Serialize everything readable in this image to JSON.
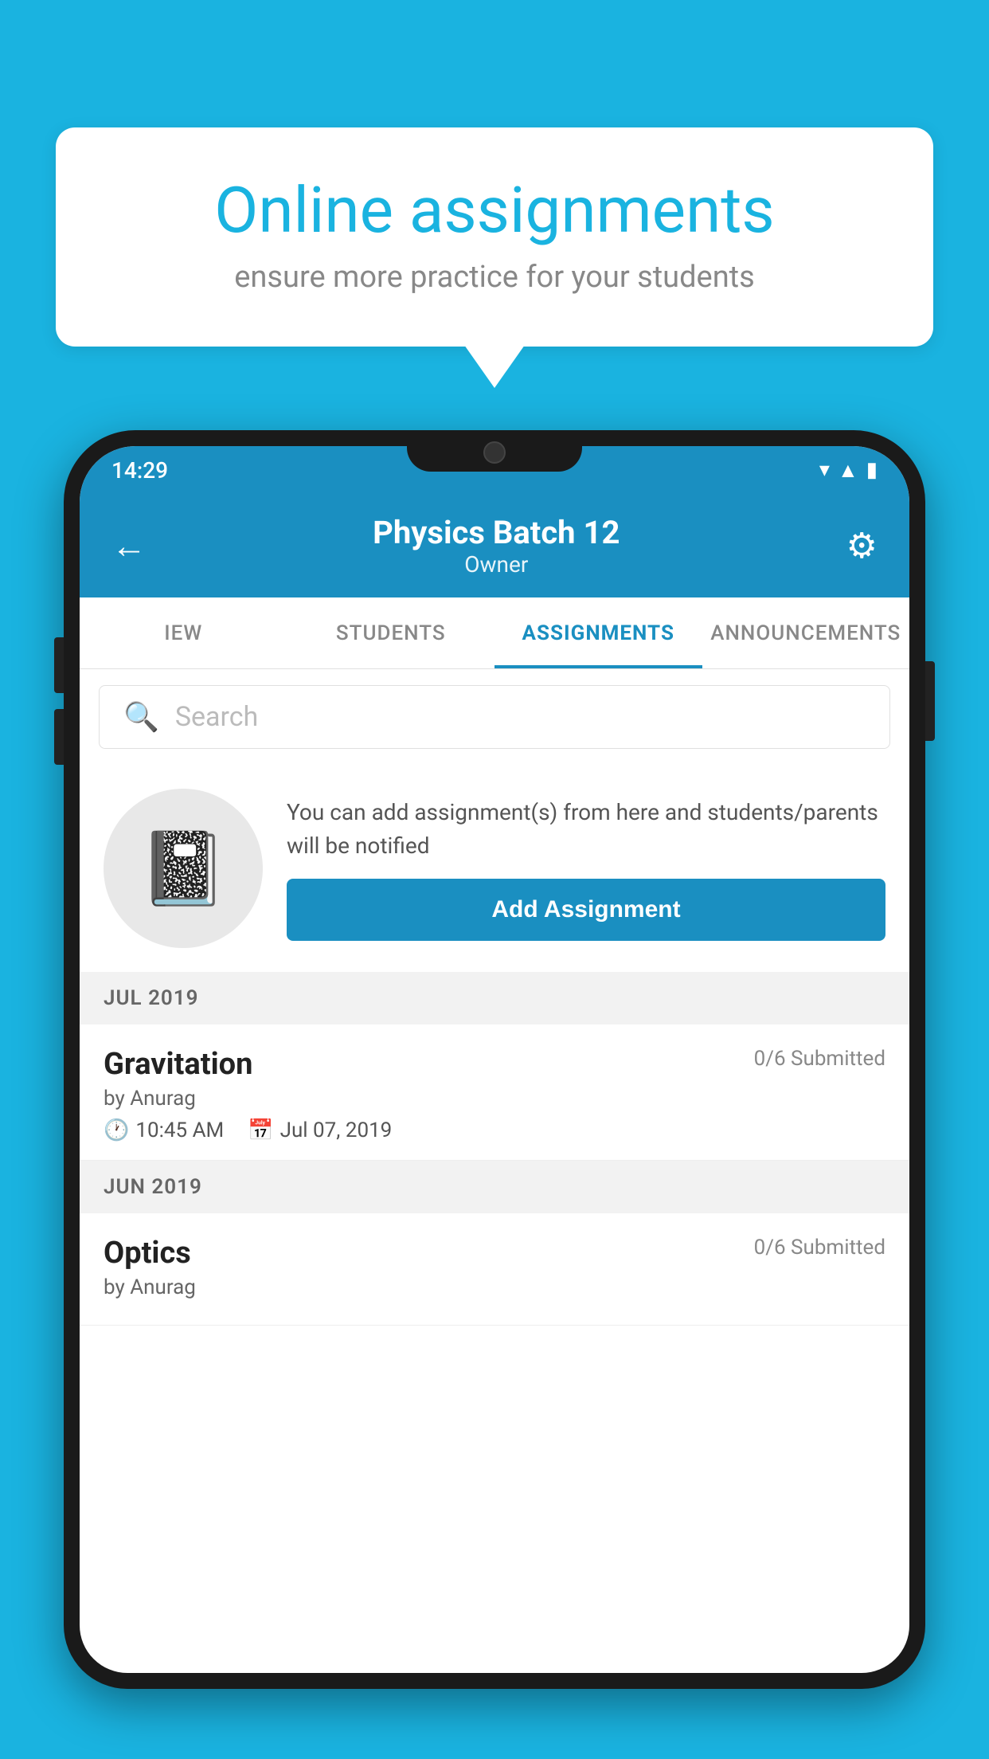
{
  "background_color": "#1ab3e0",
  "bubble": {
    "title": "Online assignments",
    "subtitle": "ensure more practice for your students"
  },
  "status_bar": {
    "time": "14:29",
    "icons": [
      "wifi",
      "signal",
      "battery"
    ]
  },
  "header": {
    "title": "Physics Batch 12",
    "subtitle": "Owner",
    "back_label": "←",
    "gear_label": "⚙"
  },
  "tabs": [
    {
      "label": "IEW",
      "active": false
    },
    {
      "label": "STUDENTS",
      "active": false
    },
    {
      "label": "ASSIGNMENTS",
      "active": true
    },
    {
      "label": "ANNOUNCEMENTS",
      "active": false
    }
  ],
  "search": {
    "placeholder": "Search"
  },
  "promo": {
    "text": "You can add assignment(s) from here and students/parents will be notified",
    "button_label": "Add Assignment"
  },
  "sections": [
    {
      "month": "JUL 2019",
      "assignments": [
        {
          "name": "Gravitation",
          "status": "0/6 Submitted",
          "by": "by Anurag",
          "time": "10:45 AM",
          "date": "Jul 07, 2019"
        }
      ]
    },
    {
      "month": "JUN 2019",
      "assignments": [
        {
          "name": "Optics",
          "status": "0/6 Submitted",
          "by": "by Anurag",
          "time": "",
          "date": ""
        }
      ]
    }
  ]
}
